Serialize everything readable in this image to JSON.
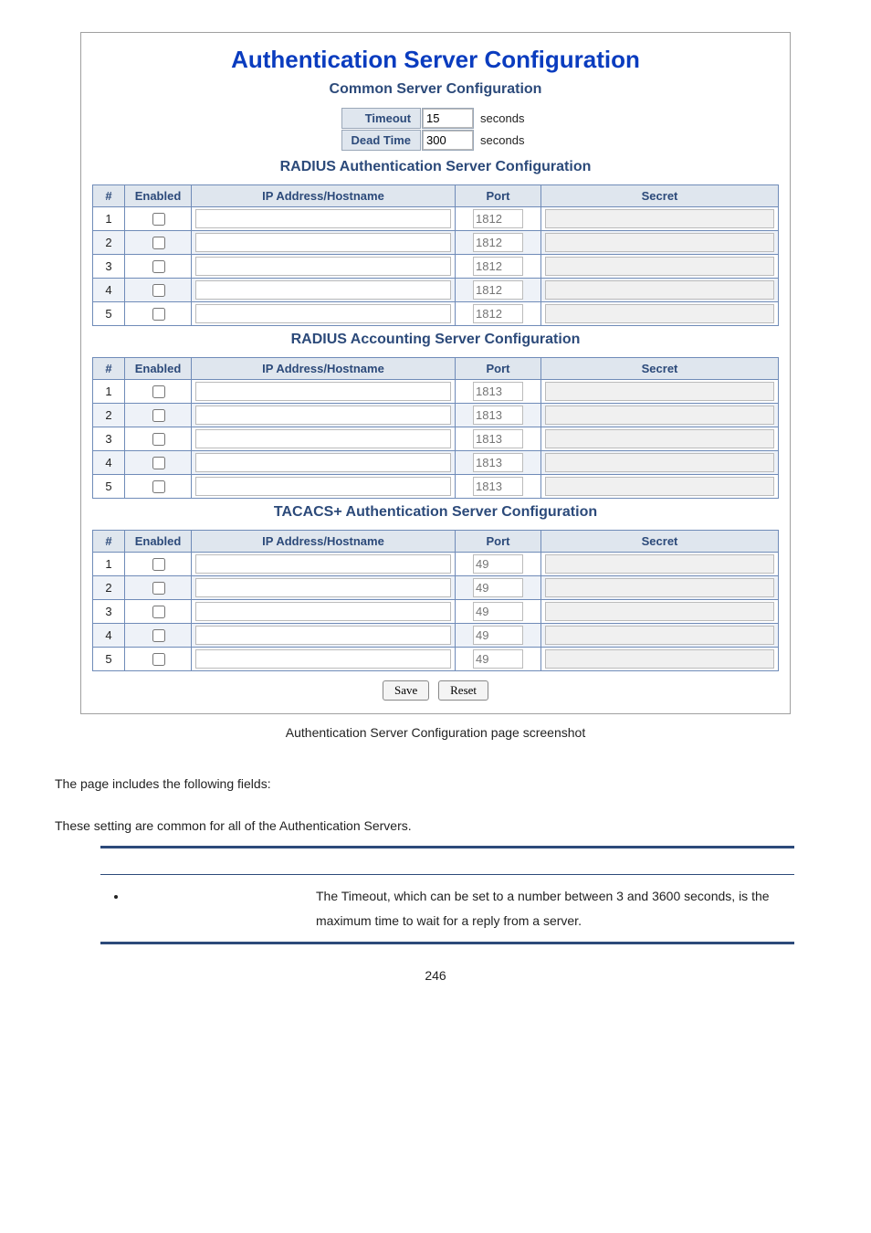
{
  "title": "Authentication Server Configuration",
  "common": {
    "heading": "Common Server Configuration",
    "timeout_label": "Timeout",
    "timeout_value": "15",
    "timeout_unit": "seconds",
    "deadtime_label": "Dead Time",
    "deadtime_value": "300",
    "deadtime_unit": "seconds"
  },
  "tables": {
    "cols": {
      "num": "#",
      "enabled": "Enabled",
      "ip": "IP Address/Hostname",
      "port": "Port",
      "secret": "Secret"
    },
    "radius_auth": {
      "heading": "RADIUS Authentication Server Configuration",
      "port_placeholder": "1812",
      "rows": [
        1,
        2,
        3,
        4,
        5
      ]
    },
    "radius_acct": {
      "heading": "RADIUS Accounting Server Configuration",
      "port_placeholder": "1813",
      "rows": [
        1,
        2,
        3,
        4,
        5
      ]
    },
    "tacacs": {
      "heading": "TACACS+ Authentication Server Configuration",
      "port_placeholder": "49",
      "rows": [
        1,
        2,
        3,
        4,
        5
      ]
    }
  },
  "buttons": {
    "save": "Save",
    "reset": "Reset"
  },
  "caption": "Authentication Server Configuration page screenshot",
  "lede": "The page includes the following fields:",
  "lede2": "These setting are common for all of the Authentication Servers.",
  "desc": {
    "bullet": "The Timeout, which can be set to a number between 3 and 3600 seconds, is the maximum time to wait for a reply from a server."
  },
  "pageno": "246"
}
